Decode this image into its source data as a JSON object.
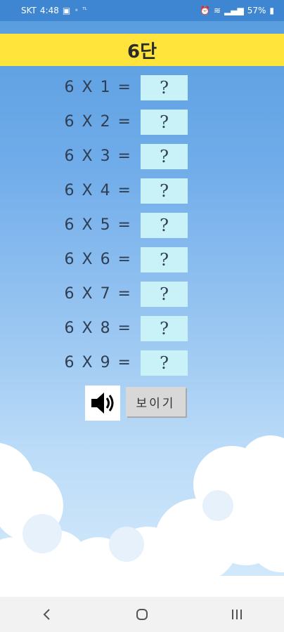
{
  "status_bar": {
    "carrier": "SKT",
    "time": "4:48",
    "extra": "ᵀᴸ",
    "battery": "57%"
  },
  "title": "6단",
  "rows": [
    {
      "equation": "6 X 1 =",
      "answer": "?"
    },
    {
      "equation": "6 X 2 =",
      "answer": "?"
    },
    {
      "equation": "6 X 3 =",
      "answer": "?"
    },
    {
      "equation": "6 X 4 =",
      "answer": "?"
    },
    {
      "equation": "6 X 5 =",
      "answer": "?"
    },
    {
      "equation": "6 X 6 =",
      "answer": "?"
    },
    {
      "equation": "6 X 7 =",
      "answer": "?"
    },
    {
      "equation": "6 X 8 =",
      "answer": "?"
    },
    {
      "equation": "6 X 9 =",
      "answer": "?"
    }
  ],
  "controls": {
    "sound_icon": "speaker-icon",
    "show_label": "보이기"
  },
  "colors": {
    "title_bar": "#ffe53b",
    "answer_box": "#c8f2f8",
    "sky_top": "#5a9ee0",
    "sky_bottom": "#d4eafb"
  }
}
